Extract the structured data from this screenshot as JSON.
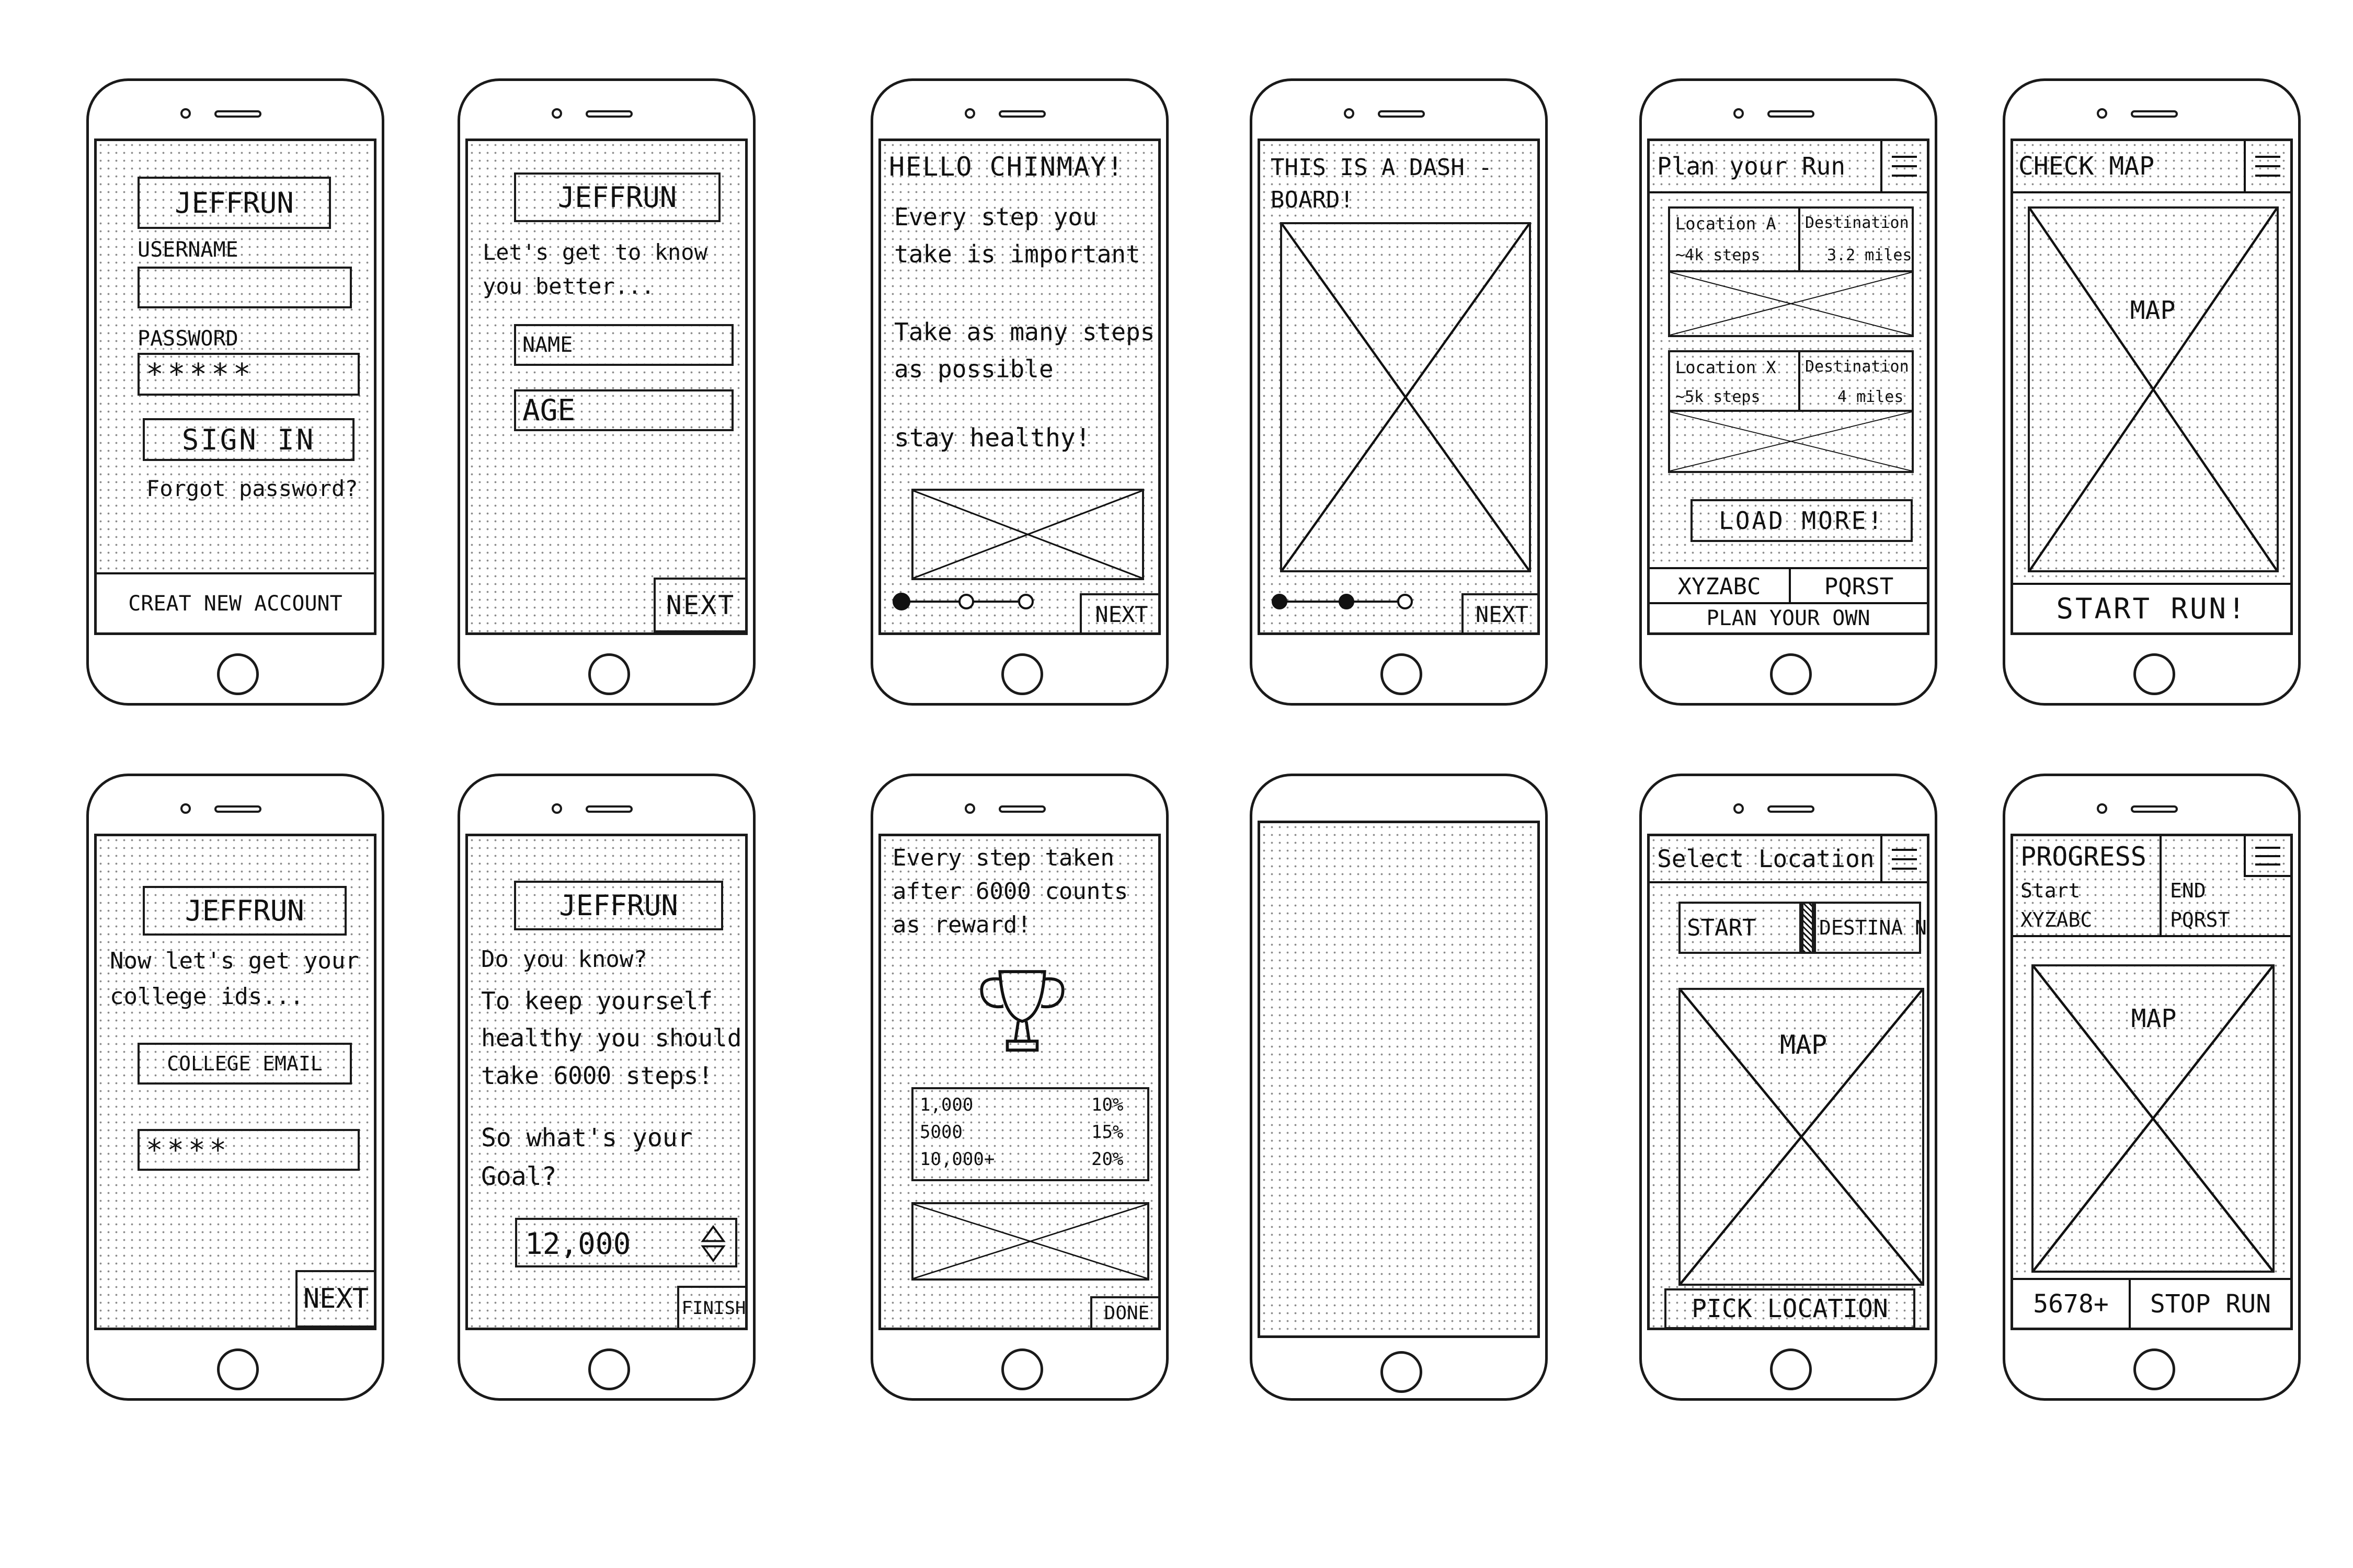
{
  "screens": {
    "login": {
      "logo": "JEFFRUN",
      "username_label": "USERNAME",
      "password_label": "PASSWORD",
      "password_value": "*****",
      "sign_in": "SIGN IN",
      "forgot": "Forgot password?",
      "create_account": "CREAT NEW ACCOUNT"
    },
    "know_you": {
      "logo": "JEFFRUN",
      "intro": "Let's get to know you better...",
      "name_placeholder": "NAME",
      "age_placeholder": "AGE",
      "next": "NEXT"
    },
    "hello": {
      "greeting": "HELLO CHINMAY!",
      "line1": "Every step you take is important",
      "line2": "Take as many steps as possible",
      "line3": "stay healthy!",
      "next": "NEXT"
    },
    "dashboard_intro": {
      "text": "THIS IS A DASH -BOARD!",
      "next": "NEXT"
    },
    "plan_run": {
      "header": "Plan your Run",
      "card1_loc": "Location A",
      "card1_steps": "~4k steps",
      "card1_dest": "Destination",
      "card1_dist": "3.2 miles",
      "card2_loc": "Location X",
      "card2_steps": "~5k steps",
      "card2_dest": "Destination",
      "card2_dist": "4 miles",
      "load_more": "LOAD MORE!",
      "tab1": "XYZABC",
      "tab2": "PQRST",
      "plan_own": "PLAN YOUR OWN"
    },
    "check_map": {
      "header": "CHECK MAP",
      "map": "MAP",
      "start_run": "START RUN!"
    },
    "college": {
      "logo": "JEFFRUN",
      "intro": "Now let's get your college ids...",
      "email_placeholder": "COLLEGE EMAIL",
      "password_value": "****",
      "next": "NEXT"
    },
    "goal": {
      "logo": "JEFFRUN",
      "q": "Do you know?",
      "fact": "To keep yourself healthy you should take 6000 steps!",
      "ask": "So what's your Goal?",
      "goal_value": "12,000",
      "finish": "FINISH"
    },
    "reward": {
      "text": "Every step taken after 6000 counts as reward!",
      "table": [
        {
          "steps": "1,000",
          "pct": "10%"
        },
        {
          "steps": "5000",
          "pct": "15%"
        },
        {
          "steps": "10,000+",
          "pct": "20%"
        }
      ],
      "done": "DONE"
    },
    "select_location": {
      "header": "Select Location",
      "start": "START",
      "destination": "DESTINA N",
      "map": "MAP",
      "pick": "PICK LOCATION"
    },
    "progress": {
      "header": "PROGRESS",
      "start_label": "Start",
      "start_value": "XYZABC",
      "end_label": "END",
      "end_value": "PQRST",
      "map": "MAP",
      "steps": "5678+",
      "stop": "STOP RUN"
    }
  },
  "icons": {
    "menu": "hamburger-menu-icon",
    "trophy": "trophy-icon",
    "stepper": "up-down-stepper-icon"
  },
  "colors": {
    "ink": "#111111",
    "paper": "#ffffff",
    "dots": "#8a8a8a"
  }
}
